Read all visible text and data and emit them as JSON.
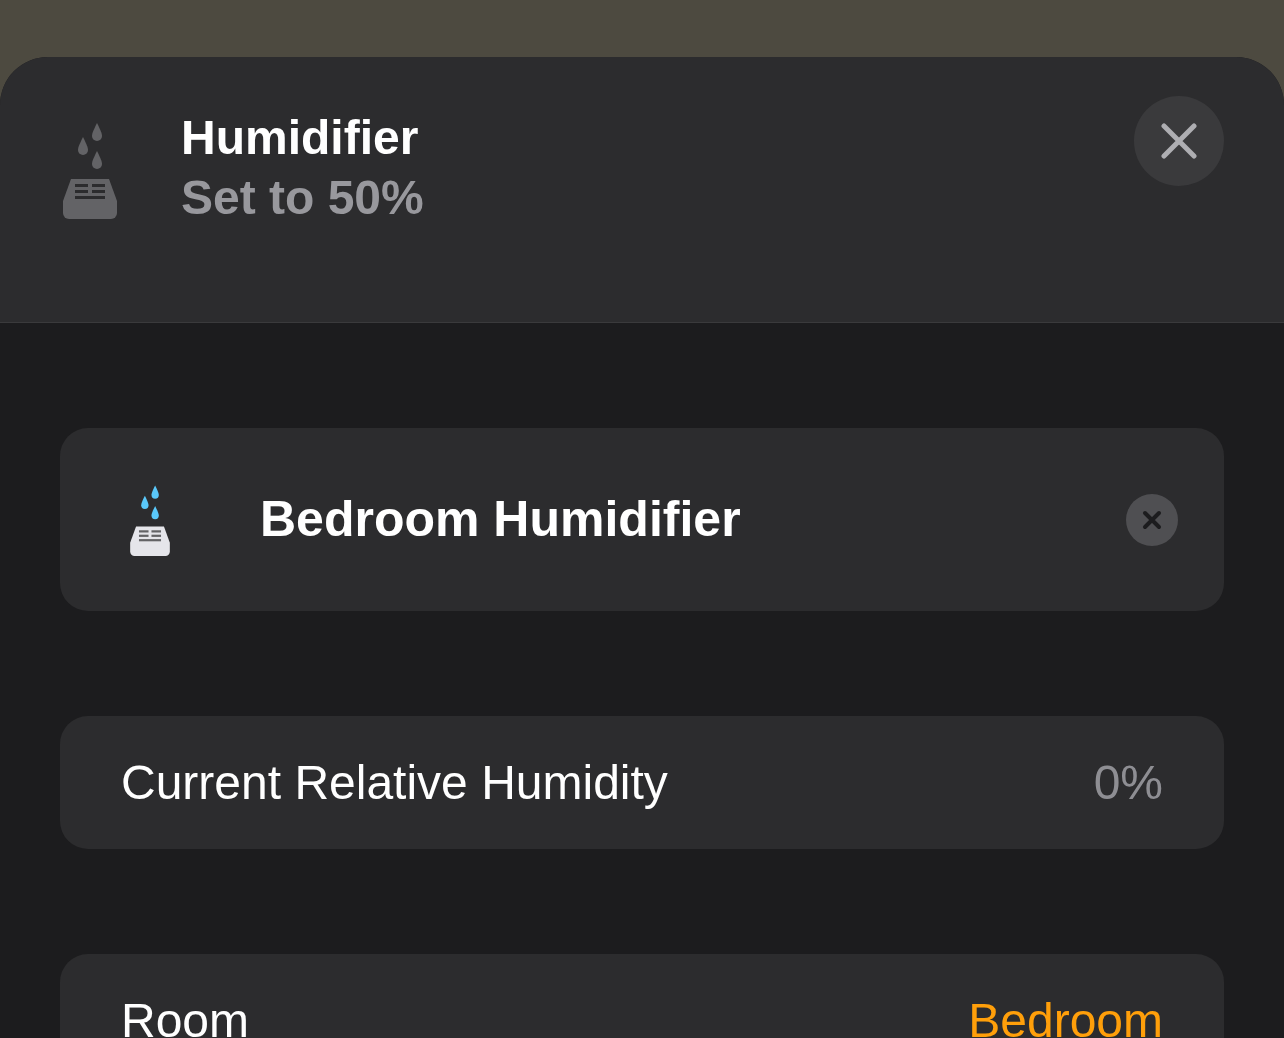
{
  "header": {
    "title": "Humidifier",
    "subtitle": "Set to 50%"
  },
  "accessory": {
    "name": "Bedroom Humidifier"
  },
  "rows": [
    {
      "label": "Current Relative Humidity",
      "value": "0%",
      "accent": false
    },
    {
      "label": "Room",
      "value": "Bedroom",
      "accent": true
    }
  ]
}
